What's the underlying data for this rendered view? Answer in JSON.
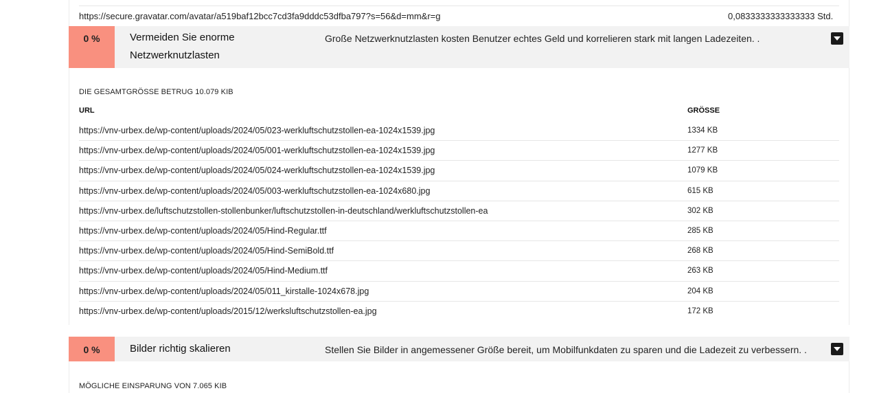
{
  "top_row": {
    "url": "https://secure.gravatar.com/avatar/a519baf12bcc7cd3fa9dddc53dfba797?s=56&d=mm&r=g",
    "value": "0,0833333333333333 Std."
  },
  "audit_network": {
    "score": "0 %",
    "title": "Vermeiden Sie enorme Netzwerknutzlasten",
    "description": "Große Netzwerknutzlasten kosten Benutzer echtes Geld und korrelieren stark mit langen Ladezeiten. .",
    "toggle_icon": "caret-down-icon",
    "summary": "Die Gesamtgröße betrug 10.079 KiB",
    "columns": {
      "url": "URL",
      "size": "GRÖSSE"
    },
    "rows": [
      {
        "url": "https://vnv-urbex.de/wp-content/uploads/2024/05/023-werkluftschutzstollen-ea-1024x1539.jpg",
        "size": "1334 KB"
      },
      {
        "url": "https://vnv-urbex.de/wp-content/uploads/2024/05/001-werkluftschutzstollen-ea-1024x1539.jpg",
        "size": "1277 KB"
      },
      {
        "url": "https://vnv-urbex.de/wp-content/uploads/2024/05/024-werkluftschutzstollen-ea-1024x1539.jpg",
        "size": "1079 KB"
      },
      {
        "url": "https://vnv-urbex.de/wp-content/uploads/2024/05/003-werkluftschutzstollen-ea-1024x680.jpg",
        "size": "615 KB"
      },
      {
        "url": "https://vnv-urbex.de/luftschutzstollen-stollenbunker/luftschutzstollen-in-deutschland/werkluftschutzstollen-ea",
        "size": "302 KB"
      },
      {
        "url": "https://vnv-urbex.de/wp-content/uploads/2024/05/Hind-Regular.ttf",
        "size": "285 KB"
      },
      {
        "url": "https://vnv-urbex.de/wp-content/uploads/2024/05/Hind-SemiBold.ttf",
        "size": "268 KB"
      },
      {
        "url": "https://vnv-urbex.de/wp-content/uploads/2024/05/Hind-Medium.ttf",
        "size": "263 KB"
      },
      {
        "url": "https://vnv-urbex.de/wp-content/uploads/2024/05/011_kirstalle-1024x678.jpg",
        "size": "204 KB"
      },
      {
        "url": "https://vnv-urbex.de/wp-content/uploads/2015/12/werksluftschutzstollen-ea.jpg",
        "size": "172 KB"
      }
    ]
  },
  "audit_images": {
    "score": "0 %",
    "title": "Bilder richtig skalieren",
    "description": "Stellen Sie Bilder in angemessener Größe bereit, um Mobilfunkdaten zu sparen und die Ladezeit zu verbessern. .",
    "toggle_icon": "caret-down-icon",
    "summary": "Mögliche Einsparung von 7.065 KiB"
  },
  "colors": {
    "badge_fail": "#f9907f",
    "audit_background": "#f2f2f2",
    "toggle": "#1a1a1a"
  }
}
